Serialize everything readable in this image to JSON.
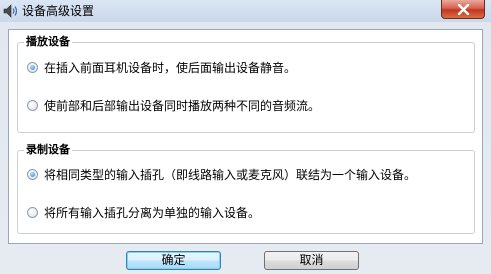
{
  "window": {
    "title": "设备高级设置",
    "icon": "speaker-icon",
    "close_icon": "close-icon"
  },
  "playback": {
    "legend": "播放设备",
    "options": [
      {
        "label": "在插入前面耳机设备时，使后面输出设备静音。",
        "checked": true
      },
      {
        "label": "使前部和后部输出设备同时播放两种不同的音频流。",
        "checked": false
      }
    ]
  },
  "recording": {
    "legend": "录制设备",
    "options": [
      {
        "label": "将相同类型的输入插孔（即线路输入或麦克风）联结为一个输入设备。",
        "checked": true
      },
      {
        "label": "将所有输入插孔分离为单独的输入设备。",
        "checked": false
      }
    ]
  },
  "buttons": {
    "ok": "确定",
    "cancel": "取消"
  }
}
